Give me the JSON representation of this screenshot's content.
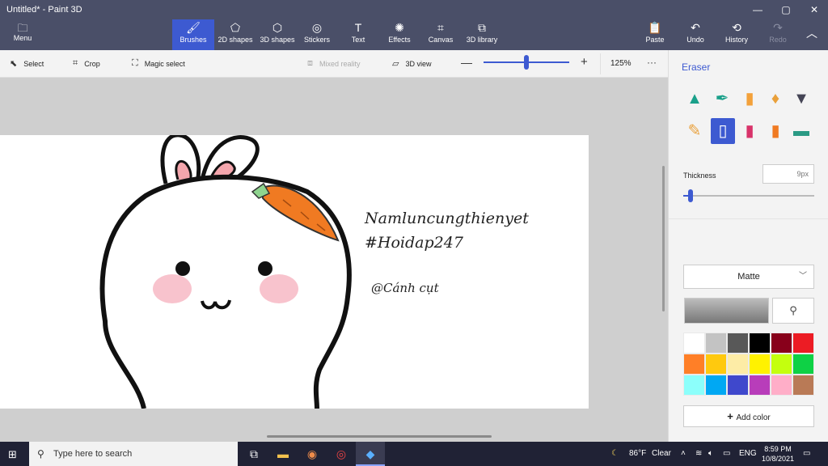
{
  "window": {
    "title": "Untitled* - Paint 3D",
    "minimize": "—",
    "maximize": "▢",
    "close": "✕"
  },
  "ribbon": {
    "menu": {
      "label": "Menu",
      "icon": "folder-icon"
    },
    "tools": [
      {
        "label": "Brushes",
        "icon": "brush-icon",
        "active": true
      },
      {
        "label": "2D shapes",
        "icon": "2d-shapes-icon"
      },
      {
        "label": "3D shapes",
        "icon": "3d-shapes-icon"
      },
      {
        "label": "Stickers",
        "icon": "sticker-icon"
      },
      {
        "label": "Text",
        "icon": "text-icon"
      },
      {
        "label": "Effects",
        "icon": "effects-icon"
      },
      {
        "label": "Canvas",
        "icon": "canvas-icon"
      },
      {
        "label": "3D library",
        "icon": "3d-library-icon"
      }
    ],
    "right": [
      {
        "label": "Paste",
        "icon": "paste-icon"
      },
      {
        "label": "Undo",
        "icon": "undo-icon"
      },
      {
        "label": "History",
        "icon": "history-icon"
      },
      {
        "label": "Redo",
        "icon": "redo-icon",
        "disabled": true
      }
    ],
    "collapse_icon": "chevron-up-icon"
  },
  "toolbar": {
    "select": "Select",
    "crop": "Crop",
    "magic_select": "Magic select",
    "mixed_reality": "Mixed reality",
    "view_3d": "3D view",
    "zoom_value": "125%",
    "zoom_level": 0.5,
    "more": "···"
  },
  "canvas": {
    "line1": "Namluncungthienyet",
    "line2": "#Hoidap247",
    "line3": "@Cánh cụt"
  },
  "panel": {
    "title": "Eraser",
    "brushes_row1": [
      {
        "icon": "marker-icon",
        "color": "#1aa08a"
      },
      {
        "icon": "calligraphy-pen-icon",
        "color": "#1aa08a"
      },
      {
        "icon": "oil-brush-icon",
        "color": "#f3a13a"
      },
      {
        "icon": "watercolor-icon",
        "color": "#e9a03a"
      },
      {
        "icon": "pixel-pen-icon",
        "color": "#445"
      }
    ],
    "brushes_row2": [
      {
        "icon": "pencil-icon",
        "color": "#e9a03a"
      },
      {
        "icon": "eraser-icon",
        "color": "#fff",
        "active": true
      },
      {
        "icon": "crayon-icon",
        "color": "#d8336a"
      },
      {
        "icon": "spray-can-icon",
        "color": "#f07a22"
      },
      {
        "icon": "fill-bucket-icon",
        "color": "#2a9a84"
      }
    ],
    "thickness_label": "Thickness",
    "thickness_value": "9px",
    "thickness_level": 0.05,
    "finish": "Matte",
    "add_color": "Add color",
    "swatches": [
      "#ffffff",
      "#c3c3c3",
      "#585858",
      "#000000",
      "#88001b",
      "#ec1c24",
      "#ff7f27",
      "#ffc90e",
      "#fdeca6",
      "#fff200",
      "#c4ff0e",
      "#0ed145",
      "#8cfffb",
      "#00a8f3",
      "#3f48cc",
      "#b83dba",
      "#ffaec8",
      "#b97a56"
    ],
    "accent": "#3d5ad1"
  },
  "taskbar": {
    "search_placeholder": "Type here to search",
    "weather_temp": "86°F",
    "weather_text": "Clear",
    "language": "ENG",
    "time": "8:59 PM",
    "date": "10/8/2021"
  }
}
